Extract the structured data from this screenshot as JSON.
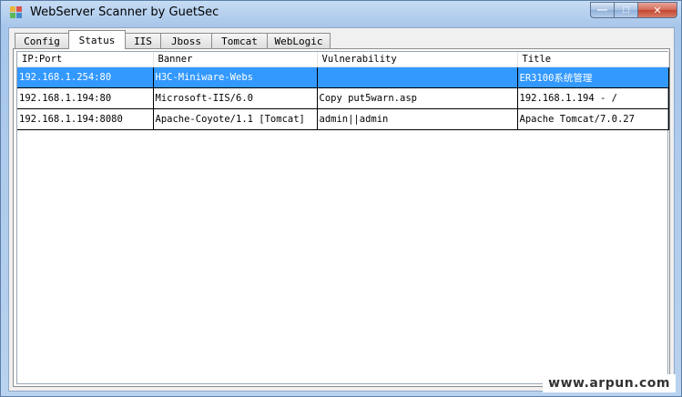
{
  "window": {
    "title": "WebServer Scanner by GuetSec",
    "app_icon": "app-grid-icon"
  },
  "controls": {
    "minimize": "—",
    "maximize": "□",
    "close": "✕"
  },
  "tabs": [
    {
      "label": "Config"
    },
    {
      "label": "Status"
    },
    {
      "label": "IIS"
    },
    {
      "label": "Jboss"
    },
    {
      "label": "Tomcat"
    },
    {
      "label": "WebLogic"
    }
  ],
  "active_tab": "Status",
  "results": {
    "columns": [
      "IP:Port",
      "Banner",
      "Vulnerability",
      "Title"
    ],
    "rows": [
      [
        "192.168.1.254:80",
        "H3C-Miniware-Webs",
        "",
        "ER3100系统管理"
      ],
      [
        "192.168.1.194:80",
        "Microsoft-IIS/6.0",
        "Copy put5warn.asp",
        "192.168.1.194 - /"
      ],
      [
        "192.168.1.194:8080",
        "Apache-Coyote/1.1 [Tomcat]",
        "admin||admin",
        "Apache Tomcat/7.0.27"
      ]
    ],
    "selected_row": 0
  },
  "watermark": "www.arpun.com",
  "colors": {
    "selection": "#3399ff",
    "title_bar": "#a7c6ea",
    "close_button": "#c24630"
  }
}
